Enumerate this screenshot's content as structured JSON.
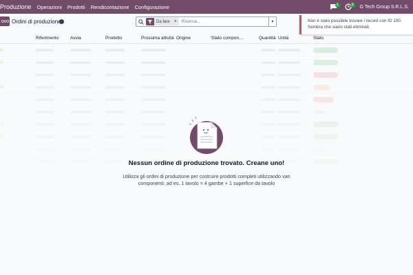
{
  "navbar": {
    "app_name": "Produzione",
    "menu": [
      "Operazioni",
      "Prodotti",
      "Rendicontazione",
      "Configurazione"
    ],
    "chat_count": "1",
    "activity_count": "9",
    "company": "G Tech Group S.R.L.S."
  },
  "control_panel": {
    "new_label": "ovo",
    "title": "Ordini di produzione",
    "search": {
      "facet_label": "Da fare",
      "placeholder": "Ricerca..."
    }
  },
  "table": {
    "columns": [
      "Riferimento",
      "Avvia",
      "Prodotto",
      "Prossima attività",
      "Origine",
      "Stato compon…",
      "Quantità",
      "Unità",
      "Stato"
    ]
  },
  "empty_state": {
    "title": "Nessun ordine di produzione trovato. Creane uno!",
    "text": "Utilizza gli ordini di produzione per costruire prodotti completi utilizzando vari componenti: ad es. 1 tavolo = 4 gambe + 1 superfice da tavolo"
  },
  "toast": {
    "message": "Non è stato possibile trovare i record con ID 100. Sembra che siano stati eliminati."
  },
  "colors": {
    "brand": "#714b67",
    "danger": "#d44c59",
    "success": "#28a745"
  }
}
